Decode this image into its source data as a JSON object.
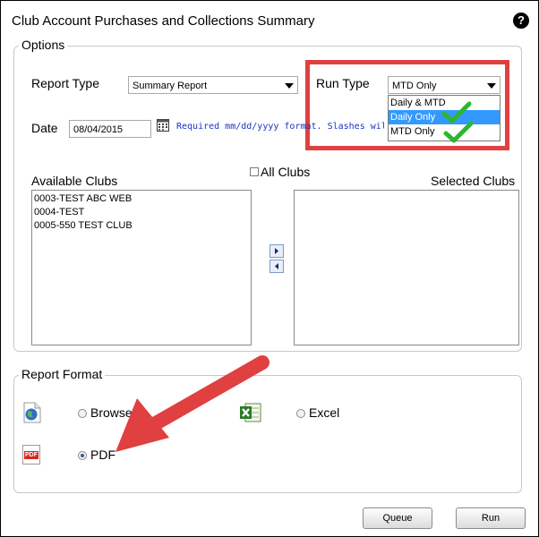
{
  "dialog": {
    "title": "Club Account Purchases and Collections Summary",
    "help_glyph": "?"
  },
  "options": {
    "legend": "Options",
    "report_type_label": "Report Type",
    "report_type_value": "Summary Report",
    "run_type_label": "Run Type",
    "run_type_value": "MTD Only",
    "run_type_options": [
      "Daily & MTD",
      "Daily Only",
      "MTD Only"
    ],
    "run_type_highlighted": "Daily Only",
    "date_label": "Date",
    "date_value": "08/04/2015",
    "date_hint": "Required mm/dd/yyyy format. Slashes will ap",
    "all_clubs_label": "All Clubs",
    "available_label": "Available Clubs",
    "selected_label": "Selected Clubs",
    "available_clubs": [
      "0003-TEST  ABC WEB",
      "0004-TEST",
      "0005-550 TEST CLUB"
    ],
    "selected_clubs": []
  },
  "report_format": {
    "legend": "Report Format",
    "browser_label": "Browser",
    "excel_label": "Excel",
    "pdf_label": "PDF",
    "pdf_icon_text": "PDF",
    "selected": "PDF"
  },
  "buttons": {
    "queue": "Queue",
    "run": "Run"
  },
  "annotation_colors": {
    "highlight_box": "#e04040",
    "arrow": "#e04040",
    "check": "#2fb52f"
  }
}
